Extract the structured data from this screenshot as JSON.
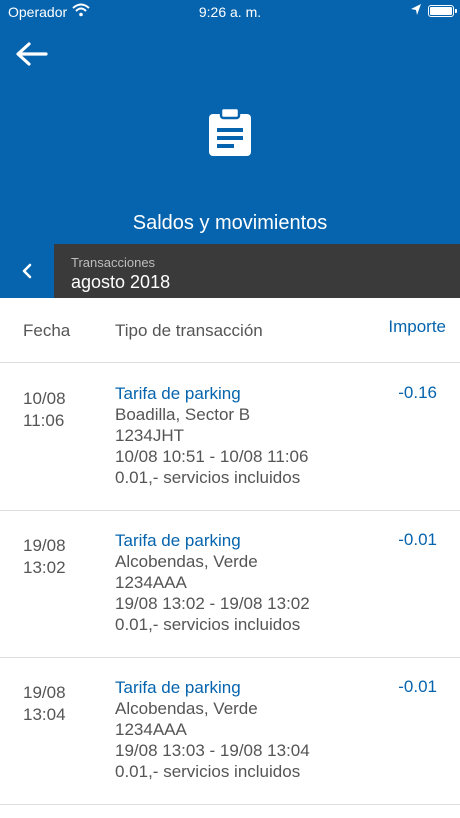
{
  "status_bar": {
    "carrier": "Operador",
    "time": "9:26 a. m."
  },
  "header": {
    "title": "Saldos y movimientos",
    "icon": "clipboard-icon"
  },
  "period": {
    "label": "Transacciones",
    "value": "agosto 2018"
  },
  "table": {
    "col_fecha": "Fecha",
    "col_tipo": "Tipo de transacción",
    "col_importe": "Importe"
  },
  "transactions": [
    {
      "date": "10/08",
      "time": "11:06",
      "type": "Tarifa de parking",
      "location": "Boadilla, Sector B",
      "plate": "1234JHT",
      "period": "10/08 10:51 - 10/08 11:06",
      "fee": "0.01,- servicios incluidos",
      "amount": "-0.16"
    },
    {
      "date": "19/08",
      "time": "13:02",
      "type": "Tarifa de parking",
      "location": "Alcobendas, Verde",
      "plate": "1234AAA",
      "period": "19/08 13:02 - 19/08 13:02",
      "fee": "0.01,- servicios incluidos",
      "amount": "-0.01"
    },
    {
      "date": "19/08",
      "time": "13:04",
      "type": "Tarifa de parking",
      "location": "Alcobendas, Verde",
      "plate": "1234AAA",
      "period": "19/08 13:03 - 19/08 13:04",
      "fee": "0.01,- servicios incluidos",
      "amount": "-0.01"
    }
  ],
  "colors": {
    "brand": "#0564ad",
    "period_bg": "#3a3a3a"
  }
}
